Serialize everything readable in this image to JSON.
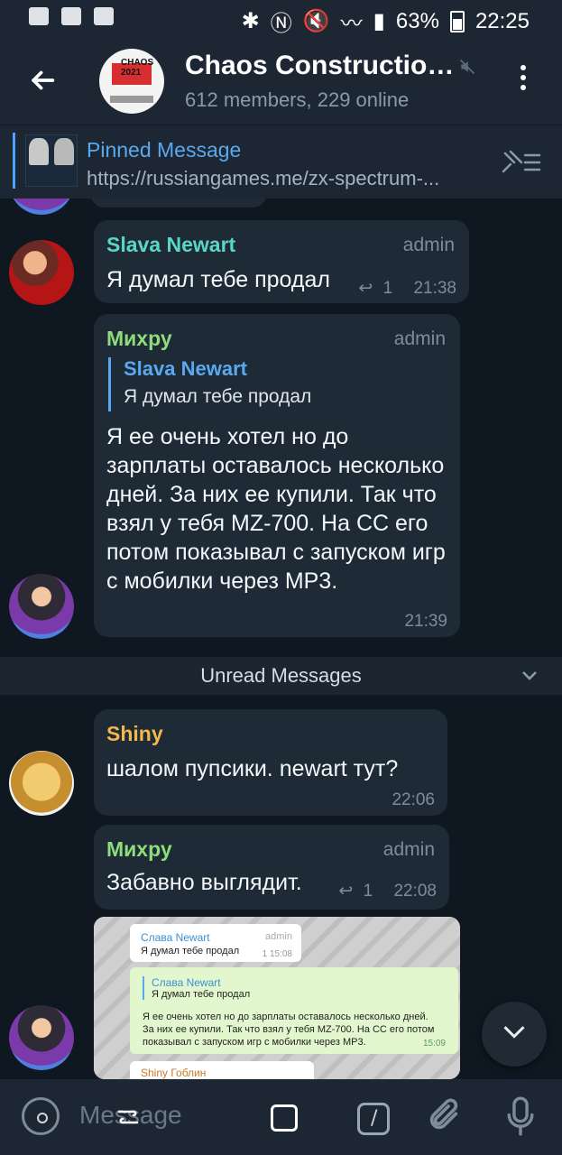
{
  "status": {
    "battery": "63%",
    "time": "22:25"
  },
  "header": {
    "title": "Chaos Construction...",
    "subtitle": "612 members, 229 online",
    "avatar_text": "CHAOS 2021"
  },
  "pinned": {
    "title": "Pinned Message",
    "text": "https://russiangames.me/zx-spectrum-..."
  },
  "messages": [
    {
      "id": "slava-1",
      "name": "Slava Newart",
      "role": "admin",
      "text": "Я думал тебе продал",
      "replies": "1",
      "time": "21:38",
      "name_color": "#5ad6c8"
    },
    {
      "id": "mihru-1",
      "name": "Михру",
      "role": "admin",
      "quote_name": "Slava Newart",
      "quote_text": "Я думал тебе продал",
      "text": "Я ее очень хотел но до зарплаты оставалось несколько дней. За них ее купили. Так что взял у тебя MZ-700. На CC его потом показывал с запуском игр с мобилки через MP3.",
      "time": "21:39",
      "name_color": "#8edc7a"
    }
  ],
  "unread": {
    "label": "Unread Messages"
  },
  "messages2": [
    {
      "id": "shiny-1",
      "name": "Shiny",
      "text": "шалом пупсики. newart тут?",
      "time": "22:06",
      "name_color": "#f2b84a"
    },
    {
      "id": "mihru-2",
      "name": "Михру",
      "role": "admin",
      "text": "Забавно выглядит.",
      "replies": "1",
      "time": "22:08",
      "name_color": "#8edc7a"
    }
  ],
  "screenshot": {
    "card1_name": "Слава Newart",
    "card1_role": "admin",
    "card1_text": "Я думал тебе продал",
    "card1_meta": "1 15:08",
    "quote_name": "Слава Newart",
    "quote_text": "Я думал тебе продал",
    "body": "Я ее очень хотел но до зарплаты оставалось несколько дней. За них ее купили. Так что взял у тебя MZ-700. На СС его потом показывал с запуском игр с мобилки через MP3.",
    "time": "15:09",
    "bottom_name": "Shiny Гоблин"
  },
  "input": {
    "placeholder": "Message"
  }
}
